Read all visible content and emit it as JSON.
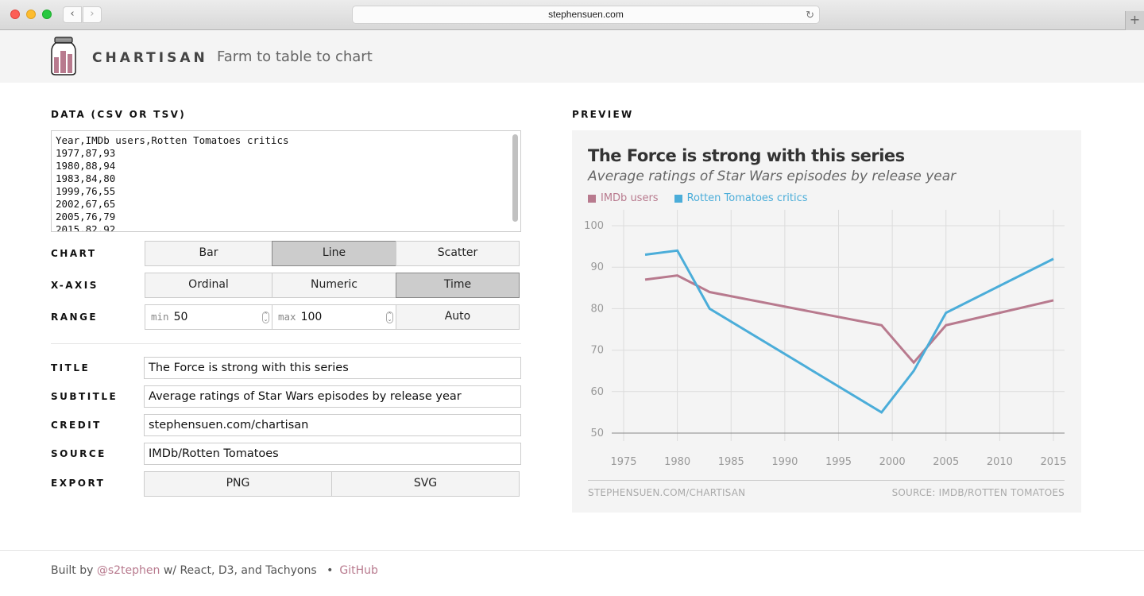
{
  "browser": {
    "url": "stephensuen.com",
    "back_icon": "‹",
    "forward_icon": "›",
    "reload_icon": "↻",
    "new_tab_icon": "+"
  },
  "header": {
    "brand": "CHARTISAN",
    "tagline": "Farm to table to chart"
  },
  "editor": {
    "data_label": "DATA (CSV OR TSV)",
    "data_text": "Year,IMDb users,Rotten Tomatoes critics\n1977,87,93\n1980,88,94\n1983,84,80\n1999,76,55\n2002,67,65\n2005,76,79\n2015,82,92",
    "chart_label": "CHART",
    "chart_options": [
      "Bar",
      "Line",
      "Scatter"
    ],
    "chart_selected": "Line",
    "xaxis_label": "X-AXIS",
    "xaxis_options": [
      "Ordinal",
      "Numeric",
      "Time"
    ],
    "xaxis_selected": "Time",
    "range_label": "RANGE",
    "range_min_placeholder": "min",
    "range_min_value": "50",
    "range_max_placeholder": "max",
    "range_max_value": "100",
    "range_auto_label": "Auto",
    "title_label": "TITLE",
    "title_value": "The Force is strong with this series",
    "subtitle_label": "SUBTITLE",
    "subtitle_value": "Average ratings of Star Wars episodes by release year",
    "credit_label": "CREDIT",
    "credit_value": "stephensuen.com/chartisan",
    "source_label": "SOURCE",
    "source_value": "IMDb/Rotten Tomatoes",
    "export_label": "EXPORT",
    "export_options": [
      "PNG",
      "SVG"
    ]
  },
  "preview": {
    "label": "PREVIEW",
    "credit": "STEPHENSUEN.COM/CHARTISAN",
    "source": "SOURCE: IMDB/ROTTEN TOMATOES"
  },
  "chart_data": {
    "type": "line",
    "title": "The Force is strong with this series",
    "subtitle": "Average ratings of Star Wars episodes by release year",
    "xlabel": "",
    "ylabel": "",
    "x": [
      1977,
      1980,
      1983,
      1999,
      2002,
      2005,
      2015
    ],
    "series": [
      {
        "name": "IMDb users",
        "color": "#b87a8e",
        "values": [
          87,
          88,
          84,
          76,
          67,
          76,
          82
        ]
      },
      {
        "name": "Rotten Tomatoes critics",
        "color": "#4badd9",
        "values": [
          93,
          94,
          80,
          55,
          65,
          79,
          92
        ]
      }
    ],
    "xlim": [
      1975,
      2015
    ],
    "ylim": [
      50,
      100
    ],
    "x_ticks": [
      "1975",
      "1980",
      "1985",
      "1990",
      "1995",
      "2000",
      "2005",
      "2010",
      "2015"
    ],
    "y_ticks": [
      "50",
      "60",
      "70",
      "80",
      "90",
      "100"
    ],
    "grid": true,
    "legend": "top-left",
    "credit": "STEPHENSUEN.COM/CHARTISAN",
    "source": "SOURCE: IMDB/ROTTEN TOMATOES"
  },
  "footer": {
    "built_by": "Built by",
    "handle": "@s2tephen",
    "tech": "w/ React, D3, and Tachyons",
    "bullet": "•",
    "github": "GitHub"
  }
}
